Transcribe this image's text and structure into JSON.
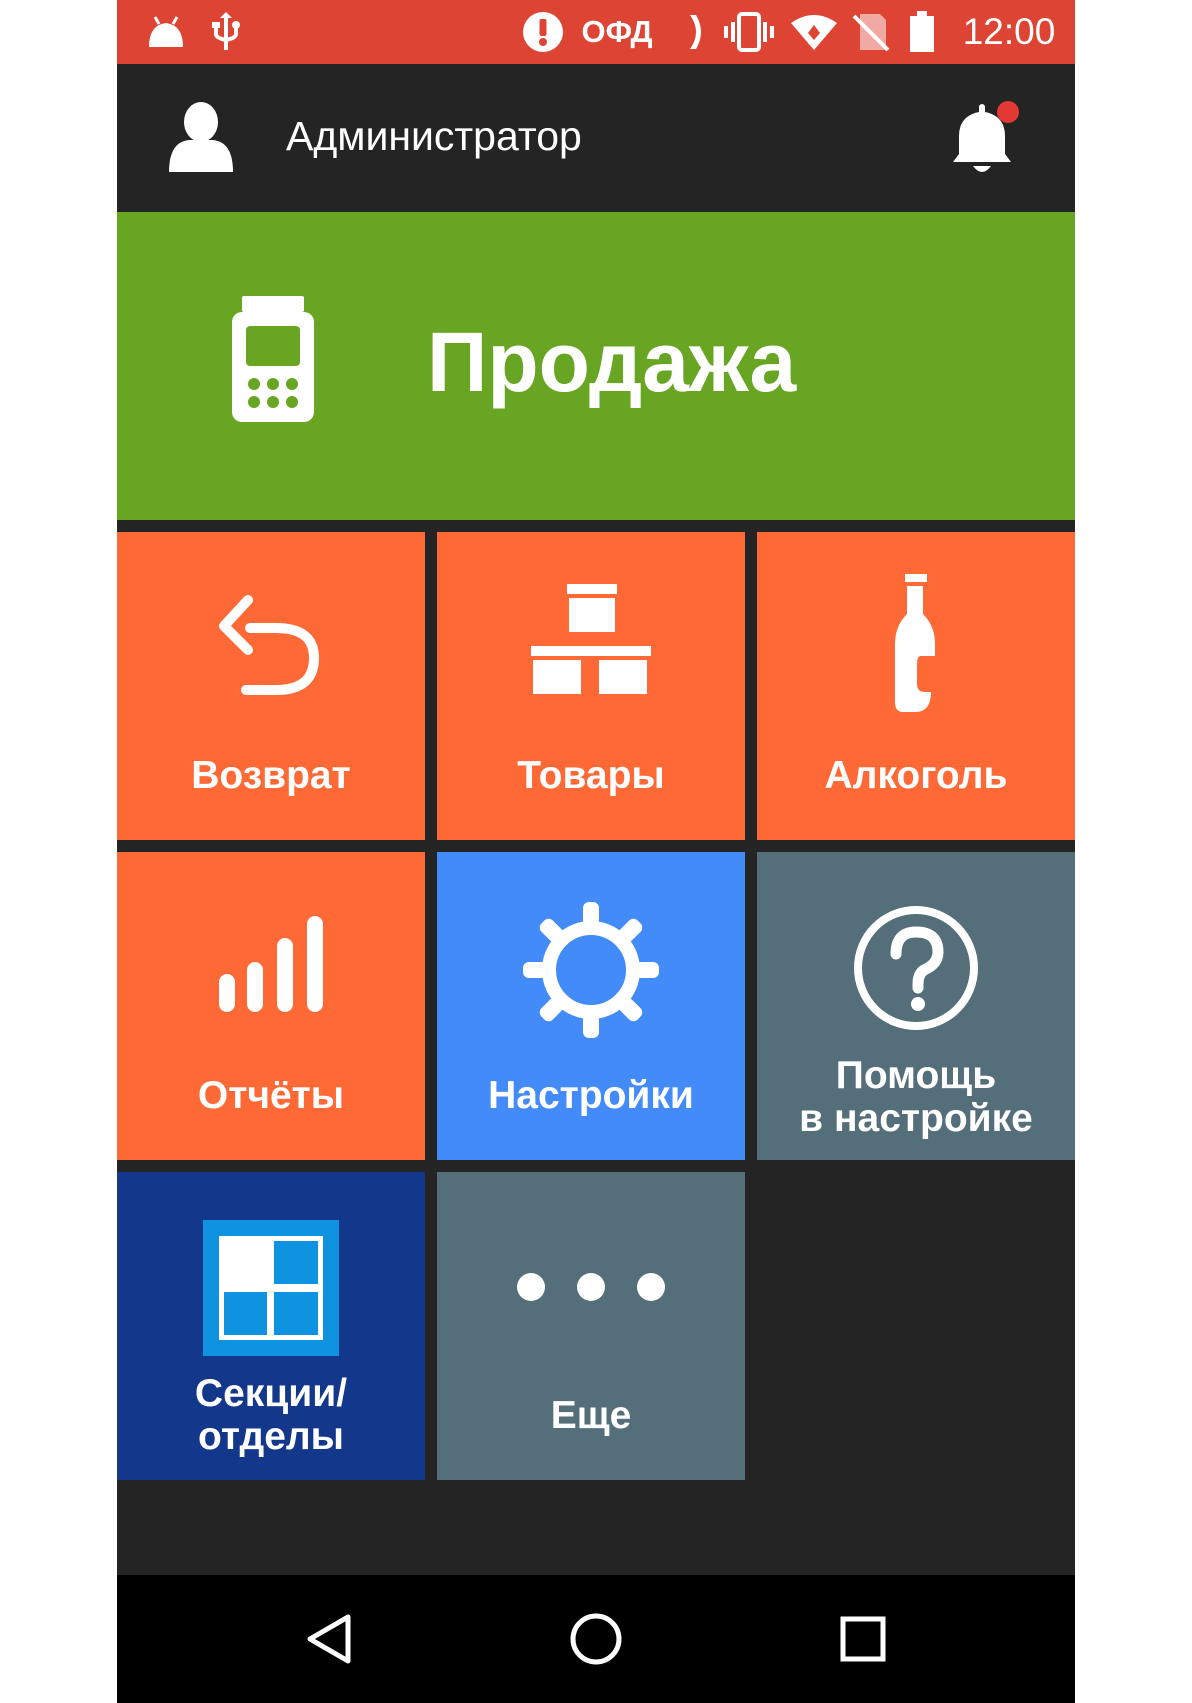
{
  "status_bar": {
    "ofd": "ОФД",
    "time": "12:00",
    "icons": [
      "android-icon",
      "usb-icon",
      "alert-icon",
      "signal-arc-icon",
      "vibrate-icon",
      "wifi-icon",
      "no-sim-icon",
      "battery-icon"
    ]
  },
  "header": {
    "user_name": "Администратор",
    "icons": [
      "user-icon",
      "bell-icon"
    ]
  },
  "sale_button": {
    "label": "Продажа",
    "icon": "card-terminal-icon"
  },
  "tiles": {
    "return": {
      "label": "Возврат",
      "icon": "undo-icon"
    },
    "goods": {
      "label": "Товары",
      "icon": "boxes-icon"
    },
    "alcohol": {
      "label": "Алкоголь",
      "icon": "bottle-icon"
    },
    "reports": {
      "label": "Отчёты",
      "icon": "bars-icon"
    },
    "settings": {
      "label": "Настройки",
      "icon": "gear-icon"
    },
    "help": {
      "label_line1": "Помощь",
      "label_line2": "в настройке",
      "icon": "help-circle-icon"
    },
    "sections": {
      "label_line1": "Секции/",
      "label_line2": "отделы",
      "icon": "grid-icon"
    },
    "more": {
      "label": "Еще",
      "icon": "more-dots-icon"
    }
  },
  "nav_bar": {
    "icons": [
      "back-icon",
      "home-icon",
      "recents-icon"
    ]
  },
  "colors": {
    "status_bar": "#dd4433",
    "background": "#242424",
    "sale": "#68a523",
    "orange_tile": "#fe6935",
    "settings_tile": "#438bf9",
    "grey_tile": "#546e7a",
    "sections_tile": "#13378a",
    "notification_dot": "#e53935"
  }
}
